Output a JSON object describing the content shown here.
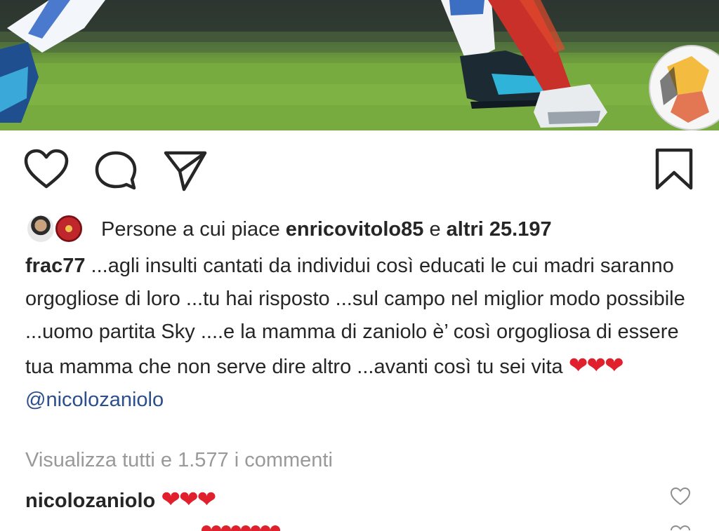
{
  "post": {
    "image_description_icon": "photo-soccer-players-and-ball"
  },
  "actions": {
    "like_icon": "heart-outline-icon",
    "comment_icon": "comment-bubble-icon",
    "share_icon": "paper-plane-icon",
    "save_icon": "bookmark-outline-icon"
  },
  "likes": {
    "prefix": "Persone a cui piace",
    "user": "enricovitolo85",
    "joiner": "e",
    "others": "altri 25.197"
  },
  "caption": {
    "username": "frac77",
    "text": "...agli insulti cantati da individui così educati le cui madri saranno orgogliose di loro ...tu hai risposto ...sul campo nel miglior modo possibile ...uomo partita Sky ....e la mamma di zaniolo è’ così orgogliosa di essere tua mamma che non serve dire altro ...avanti così tu sei vita",
    "hearts": "❤❤❤",
    "mention": "@nicolozaniolo"
  },
  "comments": {
    "view_all": "Visualizza tutti e 1.577 i commenti",
    "items": [
      {
        "username": "nicolozaniolo",
        "text": "❤❤❤"
      }
    ]
  },
  "colors": {
    "text": "#262626",
    "muted": "#999999",
    "heart": "#e0202c",
    "mention": "#2b4e8c"
  }
}
